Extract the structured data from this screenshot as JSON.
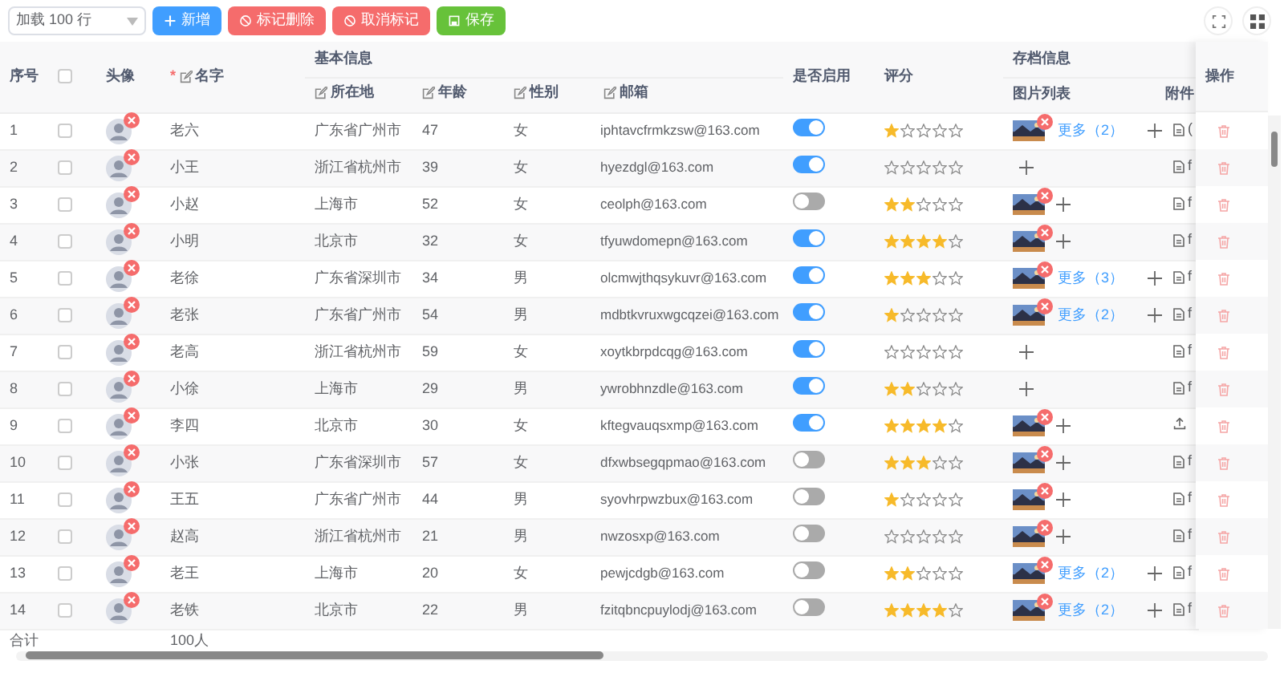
{
  "toolbar": {
    "row_limit_select": "加载 100 行",
    "buttons": [
      {
        "label": "新增",
        "kind": "add"
      },
      {
        "label": "标记删除",
        "kind": "mark"
      },
      {
        "label": "取消标记",
        "kind": "unmark"
      },
      {
        "label": "保存",
        "kind": "save"
      }
    ]
  },
  "header": {
    "index": "序号",
    "select_all_checked": false,
    "avatar": "头像",
    "name": {
      "label": "名字",
      "required_mark": "*",
      "editable": true
    },
    "basic_group": {
      "label": "基本信息",
      "columns": [
        {
          "label": "所在地",
          "editable": true
        },
        {
          "label": "年龄",
          "editable": true
        },
        {
          "label": "性别",
          "editable": true
        },
        {
          "label": "邮箱",
          "editable": true
        }
      ]
    },
    "enabled": "是否启用",
    "rating": "评分",
    "archive_group": {
      "label": "存档信息",
      "columns": [
        {
          "label": "图片列表",
          "editable": false
        },
        {
          "label": "附件",
          "editable": false
        }
      ]
    },
    "action": "操作"
  },
  "rows": [
    {
      "index": "1",
      "checked": false,
      "name": "老六",
      "location": "广东省广州市",
      "age": "47",
      "gender": "女",
      "email": "iphtavcfrmkzsw@163.com",
      "enabled": true,
      "stars": 1,
      "images": [
        {
          "kind": "picture"
        }
      ],
      "more": "更多（2）",
      "attachment": {
        "kind": "file",
        "text": "("
      }
    },
    {
      "index": "2",
      "checked": false,
      "name": "小王",
      "location": "浙江省杭州市",
      "age": "39",
      "gender": "女",
      "email": "hyezdgl@163.com",
      "enabled": true,
      "stars": 0,
      "images": [],
      "attachment": {
        "kind": "file",
        "text": "f"
      }
    },
    {
      "index": "3",
      "checked": false,
      "name": "小赵",
      "location": "上海市",
      "age": "52",
      "gender": "女",
      "email": "ceolph@163.com",
      "enabled": false,
      "stars": 2,
      "images": [
        {
          "kind": "picture"
        }
      ],
      "attachment": {
        "kind": "file",
        "text": "f"
      }
    },
    {
      "index": "4",
      "checked": false,
      "name": "小明",
      "location": "北京市",
      "age": "32",
      "gender": "女",
      "email": "tfyuwdomepn@163.com",
      "enabled": true,
      "stars": 4,
      "images": [
        {
          "kind": "picture"
        }
      ],
      "attachment": {
        "kind": "file",
        "text": "f"
      }
    },
    {
      "index": "5",
      "checked": false,
      "name": "老徐",
      "location": "广东省深圳市",
      "age": "34",
      "gender": "男",
      "email": "olcmwjthqsykuvr@163.com",
      "enabled": true,
      "stars": 3,
      "images": [
        {
          "kind": "picture"
        }
      ],
      "more": "更多（3）",
      "attachment": {
        "kind": "file",
        "text": "f"
      }
    },
    {
      "index": "6",
      "checked": false,
      "name": "老张",
      "location": "广东省广州市",
      "age": "54",
      "gender": "男",
      "email": "mdbtkvruxwgcqzei@163.com",
      "enabled": true,
      "stars": 1,
      "images": [
        {
          "kind": "picture"
        }
      ],
      "more": "更多（2）",
      "attachment": {
        "kind": "file",
        "text": "f"
      }
    },
    {
      "index": "7",
      "checked": false,
      "name": "老高",
      "location": "浙江省杭州市",
      "age": "59",
      "gender": "女",
      "email": "xoytkbrpdcqg@163.com",
      "enabled": true,
      "stars": 0,
      "images": [],
      "attachment": {
        "kind": "file",
        "text": "f"
      }
    },
    {
      "index": "8",
      "checked": false,
      "name": "小徐",
      "location": "上海市",
      "age": "29",
      "gender": "男",
      "email": "ywrobhnzdle@163.com",
      "enabled": true,
      "stars": 2,
      "images": [],
      "attachment": {
        "kind": "file",
        "text": "f"
      }
    },
    {
      "index": "9",
      "checked": false,
      "name": "李四",
      "location": "北京市",
      "age": "30",
      "gender": "女",
      "email": "kftegvauqsxmp@163.com",
      "enabled": true,
      "stars": 4,
      "images": [
        {
          "kind": "picture"
        }
      ],
      "attachment": {
        "kind": "upload"
      }
    },
    {
      "index": "10",
      "checked": false,
      "name": "小张",
      "location": "广东省深圳市",
      "age": "57",
      "gender": "女",
      "email": "dfxwbsegqpmao@163.com",
      "enabled": false,
      "stars": 3,
      "images": [
        {
          "kind": "picture"
        }
      ],
      "attachment": {
        "kind": "file",
        "text": "f"
      }
    },
    {
      "index": "11",
      "checked": false,
      "name": "王五",
      "location": "广东省广州市",
      "age": "44",
      "gender": "男",
      "email": "syovhrpwzbux@163.com",
      "enabled": false,
      "stars": 1,
      "images": [
        {
          "kind": "picture"
        }
      ],
      "attachment": {
        "kind": "file",
        "text": "f"
      }
    },
    {
      "index": "12",
      "checked": false,
      "name": "赵高",
      "location": "浙江省杭州市",
      "age": "21",
      "gender": "男",
      "email": "nwzosxp@163.com",
      "enabled": false,
      "stars": 0,
      "images": [
        {
          "kind": "picture"
        }
      ],
      "attachment": {
        "kind": "file",
        "text": "f"
      }
    },
    {
      "index": "13",
      "checked": false,
      "name": "老王",
      "location": "上海市",
      "age": "20",
      "gender": "女",
      "email": "pewjcdgb@163.com",
      "enabled": false,
      "stars": 2,
      "images": [
        {
          "kind": "picture"
        }
      ],
      "more": "更多（2）",
      "attachment": {
        "kind": "file",
        "text": "f"
      }
    },
    {
      "index": "14",
      "checked": false,
      "name": "老铁",
      "location": "北京市",
      "age": "22",
      "gender": "男",
      "email": "fzitqbncpuylodj@163.com",
      "enabled": false,
      "stars": 4,
      "images": [
        {
          "kind": "picture"
        }
      ],
      "more": "更多（2）",
      "attachment": {
        "kind": "file",
        "text": "f"
      }
    }
  ],
  "footer": {
    "label": "合计",
    "name_total": "100人"
  }
}
